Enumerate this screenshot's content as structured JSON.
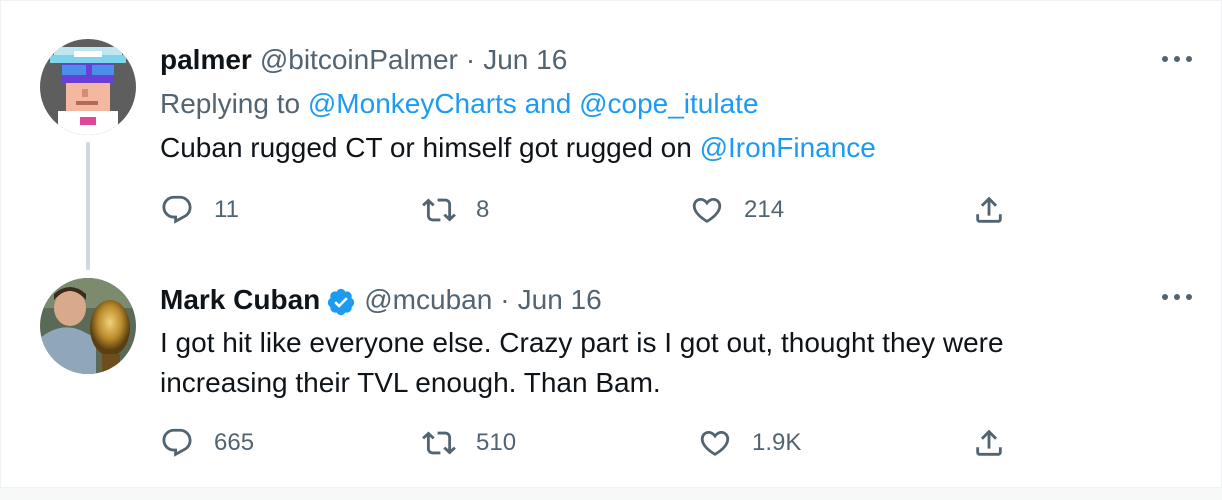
{
  "tweets": [
    {
      "name": "palmer",
      "handle": "@bitcoinPalmer",
      "separator": "·",
      "date": "Jun 16",
      "verified": false,
      "replying_prefix": "Replying to",
      "replying_to_1": "@MonkeyCharts",
      "replying_and": "and",
      "replying_to_2": "@cope_itulate",
      "text_main": "Cuban rugged CT or himself got rugged on",
      "text_mention": "@IronFinance",
      "replies": "11",
      "retweets": "8",
      "likes": "214"
    },
    {
      "name": "Mark Cuban",
      "handle": "@mcuban",
      "separator": "·",
      "date": "Jun 16",
      "verified": true,
      "text": "I got hit like everyone else. Crazy part is I got out, thought they were increasing their TVL enough. Than Bam.",
      "replies": "665",
      "retweets": "510",
      "likes": "1.9K"
    }
  ],
  "icons": {
    "reply": "reply-icon",
    "retweet": "retweet-icon",
    "like": "heart-icon",
    "share": "share-icon",
    "more": "more-icon",
    "verified": "verified-badge-icon"
  },
  "colors": {
    "text": "#0f1419",
    "secondary": "#536471",
    "link": "#1d9bf0",
    "thread_line": "#cfd9de"
  }
}
